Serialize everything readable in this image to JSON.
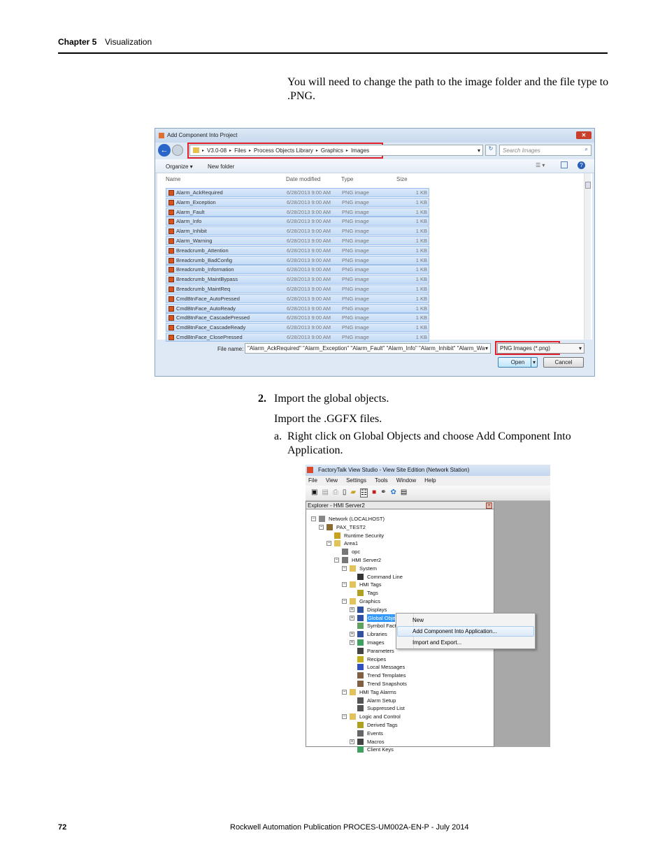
{
  "header": {
    "chapter": "Chapter 5",
    "section": "Visualization"
  },
  "intro": "You will need to change the path to the image folder and the file type to .PNG.",
  "dialog1": {
    "title": "Add Component Into Project",
    "breadcrumb": [
      "V3.0-08",
      "Files",
      "Process Objects Library",
      "Graphics",
      "Images"
    ],
    "search_placeholder": "Search Images",
    "organize": "Organize ▾",
    "new_folder": "New folder",
    "columns": [
      "Name",
      "Date modified",
      "Type",
      "Size"
    ],
    "files": [
      {
        "name": "Alarm_AckRequired",
        "date": "6/28/2013 9:00 AM",
        "type": "PNG image",
        "size": "1 KB"
      },
      {
        "name": "Alarm_Exception",
        "date": "6/28/2013 9:00 AM",
        "type": "PNG image",
        "size": "1 KB"
      },
      {
        "name": "Alarm_Fault",
        "date": "6/28/2013 9:00 AM",
        "type": "PNG image",
        "size": "1 KB"
      },
      {
        "name": "Alarm_Info",
        "date": "6/28/2013 9:00 AM",
        "type": "PNG image",
        "size": "1 KB"
      },
      {
        "name": "Alarm_Inhibit",
        "date": "6/28/2013 9:00 AM",
        "type": "PNG image",
        "size": "1 KB"
      },
      {
        "name": "Alarm_Warning",
        "date": "6/28/2013 9:00 AM",
        "type": "PNG image",
        "size": "1 KB"
      },
      {
        "name": "Breadcrumb_Attention",
        "date": "6/28/2013 9:00 AM",
        "type": "PNG image",
        "size": "1 KB"
      },
      {
        "name": "Breadcrumb_BadConfig",
        "date": "6/28/2013 9:00 AM",
        "type": "PNG image",
        "size": "1 KB"
      },
      {
        "name": "Breadcrumb_Information",
        "date": "6/28/2013 9:00 AM",
        "type": "PNG image",
        "size": "1 KB"
      },
      {
        "name": "Breadcrumb_MaintBypass",
        "date": "6/28/2013 9:00 AM",
        "type": "PNG image",
        "size": "1 KB"
      },
      {
        "name": "Breadcrumb_MaintReq",
        "date": "6/28/2013 9:00 AM",
        "type": "PNG image",
        "size": "1 KB"
      },
      {
        "name": "CmdBtnFace_AutoPressed",
        "date": "6/28/2013 9:00 AM",
        "type": "PNG image",
        "size": "1 KB"
      },
      {
        "name": "CmdBtnFace_AutoReady",
        "date": "6/28/2013 9:00 AM",
        "type": "PNG image",
        "size": "1 KB"
      },
      {
        "name": "CmdBtnFace_CascadePressed",
        "date": "6/28/2013 9:00 AM",
        "type": "PNG image",
        "size": "1 KB"
      },
      {
        "name": "CmdBtnFace_CascadeReady",
        "date": "6/28/2013 9:00 AM",
        "type": "PNG image",
        "size": "1 KB"
      },
      {
        "name": "CmdBtnFace_ClosePressed",
        "date": "6/28/2013 9:00 AM",
        "type": "PNG image",
        "size": "1 KB"
      }
    ],
    "file_name_label": "File name:",
    "file_name_value": "\"Alarm_AckRequired\" \"Alarm_Exception\" \"Alarm_Fault\" \"Alarm_Info\" \"Alarm_Inhibit\" \"Alarm_Wari",
    "file_type": "PNG Images (*.png)",
    "open": "Open",
    "cancel": "Cancel"
  },
  "step2": {
    "number": "2.",
    "text": "Import the global objects.",
    "sub": "Import the .GGFX files.",
    "a_marker": "a.",
    "a_text": "Right click on Global Objects and choose Add Component Into Application."
  },
  "dialog2": {
    "title": "FactoryTalk View Studio - View Site Edition (Network Station)",
    "menu": [
      "File",
      "View",
      "Settings",
      "Tools",
      "Window",
      "Help"
    ],
    "explorer_title": "Explorer - HMI Server2",
    "tree": [
      {
        "label": "Network (LOCALHOST)",
        "level": 0,
        "exp": "-"
      },
      {
        "label": "PAX_TEST2",
        "level": 1,
        "exp": "-"
      },
      {
        "label": "Runtime Security",
        "level": 2,
        "exp": ""
      },
      {
        "label": "Area1",
        "level": 2,
        "exp": "-"
      },
      {
        "label": "opc",
        "level": 3,
        "exp": ""
      },
      {
        "label": "HMI Server2",
        "level": 3,
        "exp": "-"
      },
      {
        "label": "System",
        "level": 4,
        "exp": "-"
      },
      {
        "label": "Command Line",
        "level": 5,
        "exp": ""
      },
      {
        "label": "HMI Tags",
        "level": 4,
        "exp": "-"
      },
      {
        "label": "Tags",
        "level": 5,
        "exp": ""
      },
      {
        "label": "Graphics",
        "level": 4,
        "exp": "-"
      },
      {
        "label": "Displays",
        "level": 5,
        "exp": "+"
      },
      {
        "label": "Global Objects",
        "level": 5,
        "exp": "+",
        "selected": true
      },
      {
        "label": "Symbol Factory",
        "level": 5,
        "exp": ""
      },
      {
        "label": "Libraries",
        "level": 5,
        "exp": "+"
      },
      {
        "label": "Images",
        "level": 5,
        "exp": "+"
      },
      {
        "label": "Parameters",
        "level": 5,
        "exp": ""
      },
      {
        "label": "Recipes",
        "level": 5,
        "exp": ""
      },
      {
        "label": "Local Messages",
        "level": 5,
        "exp": ""
      },
      {
        "label": "Trend Templates",
        "level": 5,
        "exp": ""
      },
      {
        "label": "Trend Snapshots",
        "level": 5,
        "exp": ""
      },
      {
        "label": "HMI Tag Alarms",
        "level": 4,
        "exp": "-"
      },
      {
        "label": "Alarm Setup",
        "level": 5,
        "exp": ""
      },
      {
        "label": "Suppressed List",
        "level": 5,
        "exp": ""
      },
      {
        "label": "Logic and Control",
        "level": 4,
        "exp": "-"
      },
      {
        "label": "Derived Tags",
        "level": 5,
        "exp": ""
      },
      {
        "label": "Events",
        "level": 5,
        "exp": ""
      },
      {
        "label": "Macros",
        "level": 5,
        "exp": "+"
      },
      {
        "label": "Client Keys",
        "level": 5,
        "exp": ""
      }
    ],
    "context_menu": [
      "New",
      "Add Component Into Application...",
      "Import and Export..."
    ]
  },
  "footer": {
    "page": "72",
    "publication": "Rockwell Automation Publication PROCES-UM002A-EN-P - July 2014"
  }
}
